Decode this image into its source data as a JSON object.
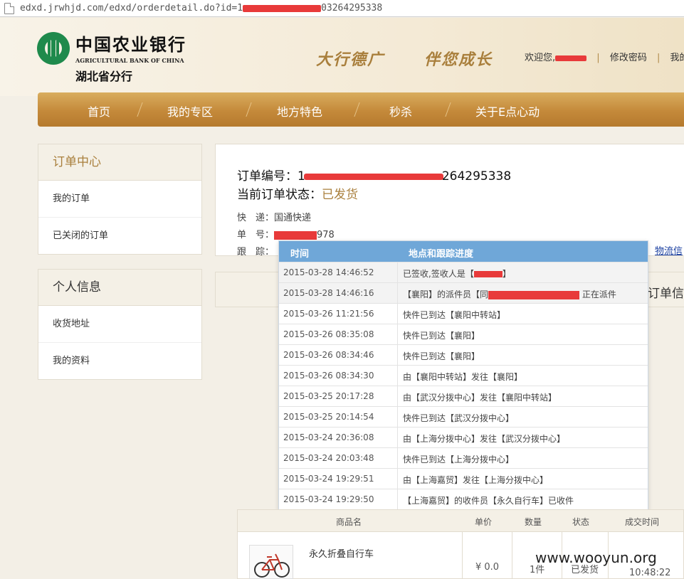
{
  "browser": {
    "url_prefix": "edxd.jrwhjd.com/edxd/orderdetail.do?id=1",
    "url_suffix": "03264295338"
  },
  "header": {
    "bank_name_cn": "中国农业银行",
    "bank_name_en": "AGRICULTURAL BANK OF CHINA",
    "branch": "湖北省分行",
    "slogan_1": "大行德广",
    "slogan_2": "伴您成长",
    "welcome": "欢迎您,",
    "change_password": "修改密码",
    "my_link": "我的"
  },
  "nav": {
    "items": [
      "首页",
      "我的专区",
      "地方特色",
      "秒杀",
      "关于E点心动"
    ]
  },
  "sidebar": {
    "order_center": {
      "title": "订单中心",
      "items": [
        "我的订单",
        "已关闭的订单"
      ]
    },
    "personal_info": {
      "title": "个人信息",
      "items": [
        "收货地址",
        "我的资料"
      ]
    }
  },
  "order": {
    "number_label": "订单编号：",
    "number_prefix": "1",
    "number_suffix": "264295338",
    "status_label": "当前订单状态：",
    "status_value": "已发货",
    "express_label": "快　递：",
    "express_value": "国通快递",
    "tracking_no_label": "单　号：",
    "tracking_no_suffix": "978",
    "track_label": "跟　踪：",
    "logistics_link": "物流信",
    "second_title": "订单信"
  },
  "tracking": {
    "headers": [
      "时间",
      "地点和跟踪进度"
    ],
    "rows": [
      {
        "time": "2015-03-28 14:46:52",
        "desc": "已签收,签收人是【",
        "desc_end": "】"
      },
      {
        "time": "2015-03-28 14:46:16",
        "desc": "【襄阳】的派件员【同",
        "desc_end": "正在派件"
      },
      {
        "time": "2015-03-26 11:21:56",
        "desc": "快件已到达【襄阳中转站】"
      },
      {
        "time": "2015-03-26 08:35:08",
        "desc": "快件已到达【襄阳】"
      },
      {
        "time": "2015-03-26 08:34:46",
        "desc": "快件已到达【襄阳】"
      },
      {
        "time": "2015-03-26 08:34:30",
        "desc": "由【襄阳中转站】发往【襄阳】"
      },
      {
        "time": "2015-03-25 20:17:28",
        "desc": "由【武汉分拨中心】发往【襄阳中转站】"
      },
      {
        "time": "2015-03-25 20:14:54",
        "desc": "快件已到达【武汉分拨中心】"
      },
      {
        "time": "2015-03-24 20:36:08",
        "desc": "由【上海分拨中心】发往【武汉分拨中心】"
      },
      {
        "time": "2015-03-24 20:03:48",
        "desc": "快件已到达【上海分拨中心】"
      },
      {
        "time": "2015-03-24 19:29:51",
        "desc": "由【上海嘉贸】发往【上海分拨中心】"
      },
      {
        "time": "2015-03-24 19:29:50",
        "desc": "【上海嘉贸】的收件员【永久自行车】已收件"
      }
    ]
  },
  "goods": {
    "headers": {
      "name": "商品名",
      "price": "单价",
      "qty": "数量",
      "status": "状态",
      "time": "成交时间"
    },
    "item": {
      "name": "永久折叠自行车",
      "price": "¥ 0.0",
      "qty": "1件",
      "status": "已发货",
      "time": "10:48:22"
    }
  },
  "watermark": "www.wooyun.org"
}
